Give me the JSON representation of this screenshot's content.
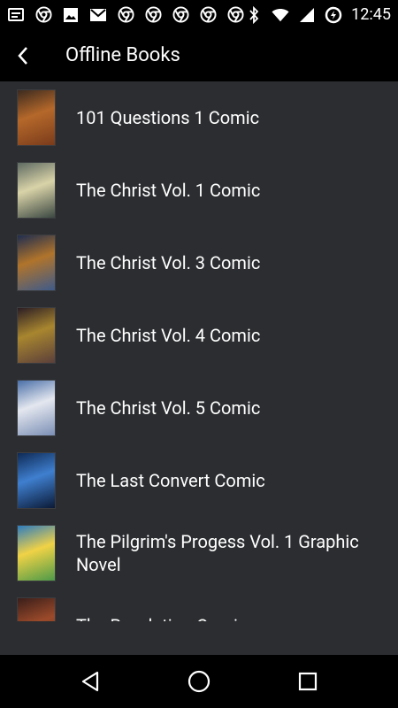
{
  "status_bar": {
    "time": "12:45",
    "left_icons": [
      "notification-icon",
      "chrome-icon",
      "image-icon",
      "gmail-icon",
      "chrome-icon",
      "chrome-icon",
      "chrome-icon",
      "chrome-icon",
      "chrome-icon"
    ],
    "right_icons": [
      "bluetooth-icon",
      "wifi-icon",
      "signal-icon",
      "data-saver-icon"
    ]
  },
  "app_bar": {
    "title": "Offline Books"
  },
  "books": [
    {
      "title": "101 Questions 1 Comic",
      "cover_colors": [
        "#3b2a1f",
        "#b5682a",
        "#7a3b1b"
      ]
    },
    {
      "title": "The Christ Vol. 1 Comic",
      "cover_colors": [
        "#5e6a62",
        "#d9d3a8",
        "#3b4842"
      ]
    },
    {
      "title": "The Christ Vol. 3 Comic",
      "cover_colors": [
        "#1f2d4f",
        "#b0742b",
        "#3e5a8a"
      ]
    },
    {
      "title": "The Christ Vol. 4 Comic",
      "cover_colors": [
        "#2b1d24",
        "#a8862f",
        "#5b3f3a"
      ]
    },
    {
      "title": "The Christ Vol. 5 Comic",
      "cover_colors": [
        "#4a6fa8",
        "#e4e7ef",
        "#7b8fb5"
      ]
    },
    {
      "title": "The Last Convert Comic",
      "cover_colors": [
        "#0e2a55",
        "#3f7fcf",
        "#0b1a36"
      ]
    },
    {
      "title": "The Pilgrim's Progess Vol. 1 Graphic Novel",
      "cover_colors": [
        "#2d7cc0",
        "#f0d246",
        "#4d9a48"
      ]
    },
    {
      "title": "The Revelation Comic",
      "cover_colors": [
        "#3a1e1a",
        "#9b4a2a",
        "#5e2f23"
      ]
    }
  ],
  "colors": {
    "background": "#2b2d30",
    "bars": "#000000",
    "text": "#ffffff"
  }
}
